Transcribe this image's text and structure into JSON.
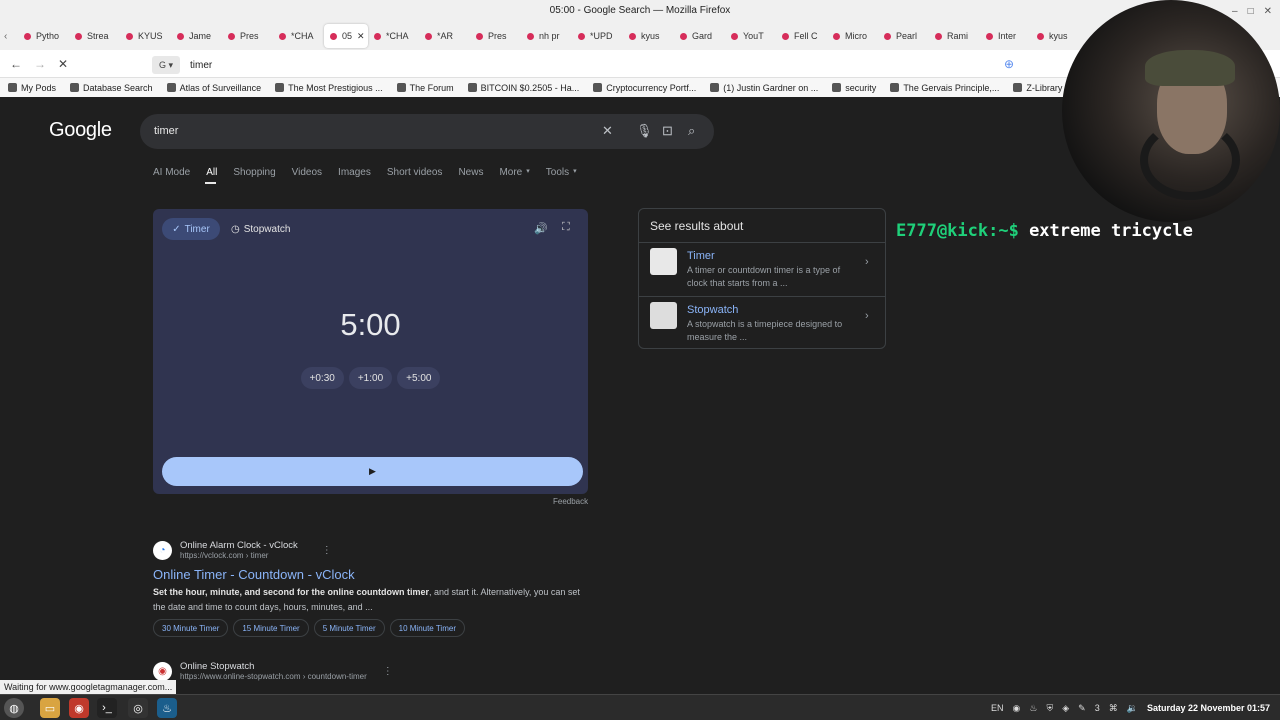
{
  "window": {
    "title": "05:00 - Google Search — Mozilla Firefox"
  },
  "tabs": [
    {
      "label": "Pytho"
    },
    {
      "label": "Strea"
    },
    {
      "label": "KYUS"
    },
    {
      "label": "Jame"
    },
    {
      "label": "Pres"
    },
    {
      "label": "*CHA"
    },
    {
      "label": "05",
      "active": true
    },
    {
      "label": "*CHA"
    },
    {
      "label": "*AR"
    },
    {
      "label": "Pres"
    },
    {
      "label": "nh pr"
    },
    {
      "label": "*UPD"
    },
    {
      "label": "kyus"
    },
    {
      "label": "Gard"
    },
    {
      "label": "YouT"
    },
    {
      "label": "Fell C"
    },
    {
      "label": "Micro"
    },
    {
      "label": "Pearl"
    },
    {
      "label": "Rami"
    },
    {
      "label": "Inter"
    },
    {
      "label": "kyus"
    }
  ],
  "nav": {
    "url": "timer"
  },
  "bookmarks": [
    "My Pods",
    "Database Search",
    "Atlas of Surveillance",
    "The Most Prestigious ...",
    "The Forum",
    "BITCOIN $0.2505 - Ha...",
    "Cryptocurrency Portf...",
    "(1) Justin Gardner on ...",
    "security",
    "The Gervais Principle,...",
    "Z-Library – the world'"
  ],
  "google": {
    "logo": "Google",
    "query": "timer",
    "tabs": [
      "AI Mode",
      "All",
      "Shopping",
      "Videos",
      "Images",
      "Short videos",
      "News",
      "More",
      "Tools"
    ]
  },
  "timer_widget": {
    "mode_timer": "Timer",
    "mode_stopwatch": "Stopwatch",
    "display": "5:00",
    "add_buttons": [
      "+0:30",
      "+1:00",
      "+5:00"
    ],
    "feedback": "Feedback"
  },
  "knowledge_panel": {
    "title": "See results about",
    "items": [
      {
        "name": "Timer",
        "desc": "A timer or countdown timer is a type of clock that starts from a ..."
      },
      {
        "name": "Stopwatch",
        "desc": "A stopwatch is a timepiece designed to measure the ..."
      }
    ]
  },
  "overlay": {
    "prompt": "E777@kick:~$ ",
    "command": "extreme tricycle"
  },
  "results": [
    {
      "site": "Online Alarm Clock - vClock",
      "url": "https://vclock.com › timer",
      "title": "Online Timer - Countdown - vClock",
      "snippet_bold": "Set the hour, minute, and second for the online countdown timer",
      "snippet_rest": ", and start it. Alternatively, you can set the date and time to count days, hours, minutes, and ...",
      "chips": [
        "30 Minute Timer",
        "15 Minute Timer",
        "5 Minute Timer",
        "10 Minute Timer"
      ]
    },
    {
      "site": "Online Stopwatch",
      "url": "https://www.online-stopwatch.com › countdown-timer"
    }
  ],
  "status": "Waiting for www.googletagmanager.com...",
  "taskbar": {
    "lang": "EN",
    "workspace": "3",
    "datetime": "Saturday 22 November 01:57"
  }
}
